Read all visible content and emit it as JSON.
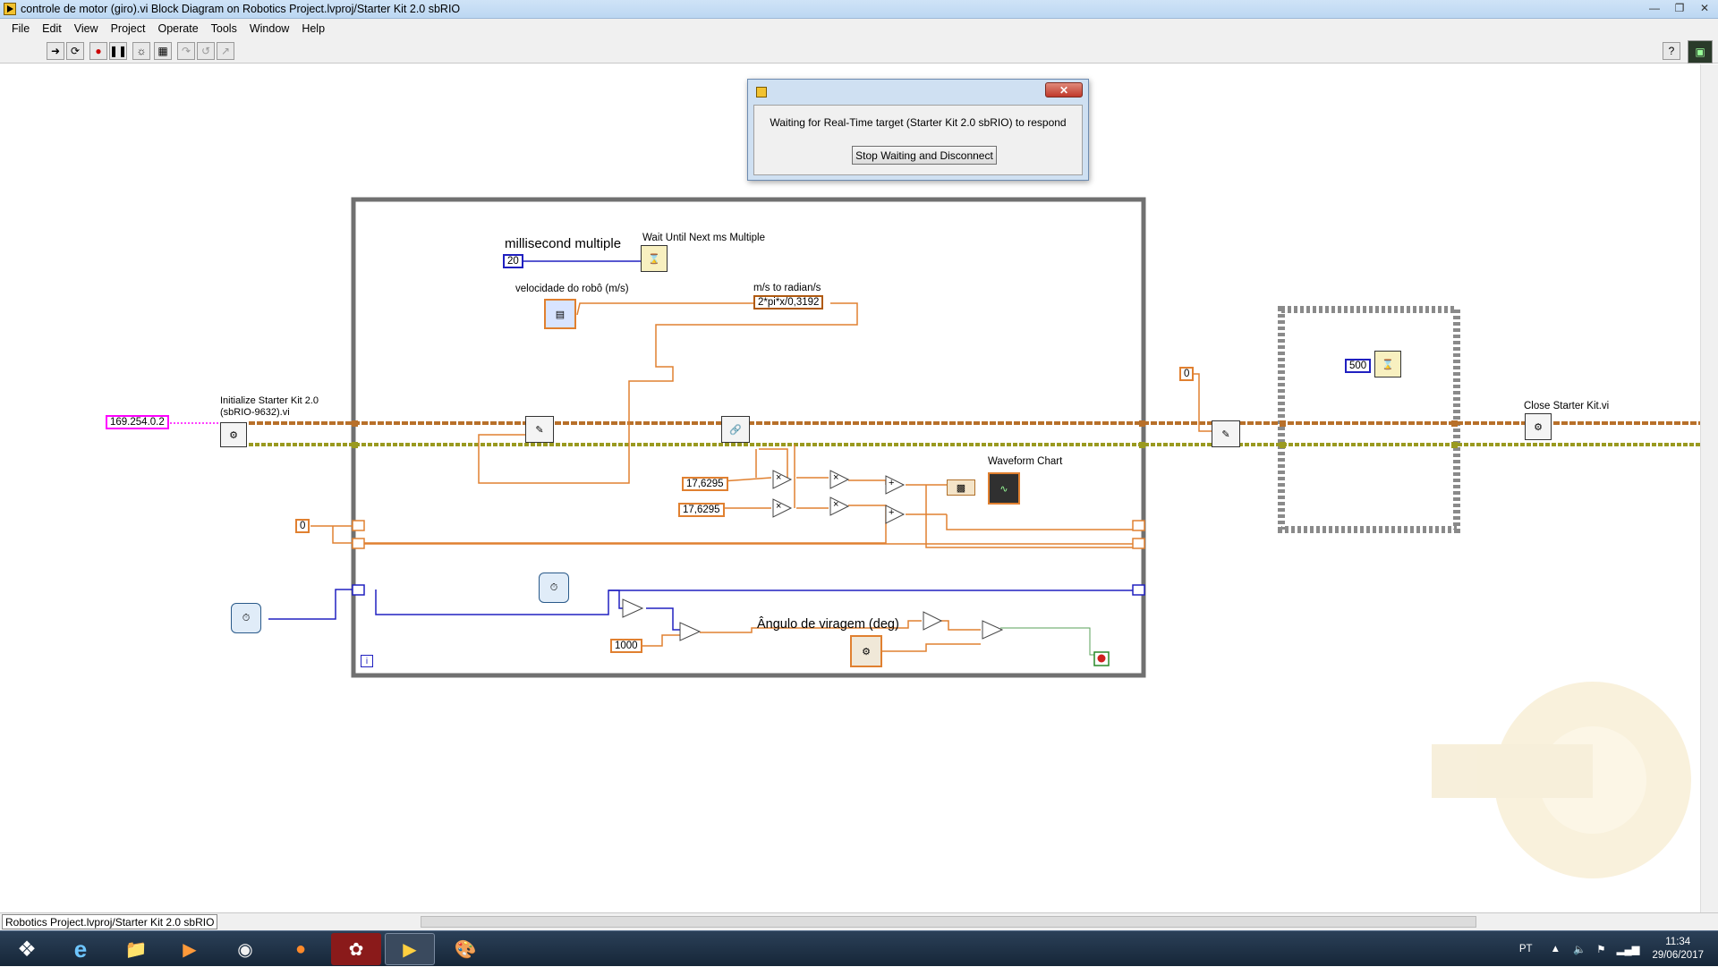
{
  "window": {
    "title": "controle de motor (giro).vi Block Diagram on Robotics Project.lvproj/Starter Kit 2.0 sbRIO"
  },
  "menu": [
    "File",
    "Edit",
    "View",
    "Project",
    "Operate",
    "Tools",
    "Window",
    "Help"
  ],
  "dialog": {
    "message": "Waiting for Real-Time target (Starter Kit 2.0 sbRIO) to respond",
    "button": "Stop Waiting and Disconnect"
  },
  "diagram": {
    "ip_constant": "169.254.0.2",
    "init_label_1": "Initialize Starter Kit 2.0",
    "init_label_2": "(sbRIO-9632).vi",
    "ms_label": "millisecond multiple",
    "ms_value": "20",
    "wait_label": "Wait Until Next ms Multiple",
    "velocity_label": "velocidade do robô (m/s)",
    "conversion_label": "m/s to radian/s",
    "formula": "2*pi*x/0,3192",
    "const_a": "17,6295",
    "const_b": "17,6295",
    "zero_left": "0",
    "const_1000": "1000",
    "angle_label": "Ângulo de viragem (deg)",
    "chart_label": "Waveform Chart",
    "zero_right": "0",
    "wait_500": "500",
    "close_label": "Close Starter Kit.vi",
    "loop_index": "i"
  },
  "status": {
    "path": "Robotics Project.lvproj/Starter Kit 2.0 sbRIO"
  },
  "tray": {
    "lang": "PT",
    "time": "11:34",
    "date": "29/06/2017"
  },
  "colors": {
    "orange_wire": "#e08030",
    "blue_wire": "#2020c0",
    "green_wire": "#5aa05a",
    "loop_border": "#707070"
  }
}
